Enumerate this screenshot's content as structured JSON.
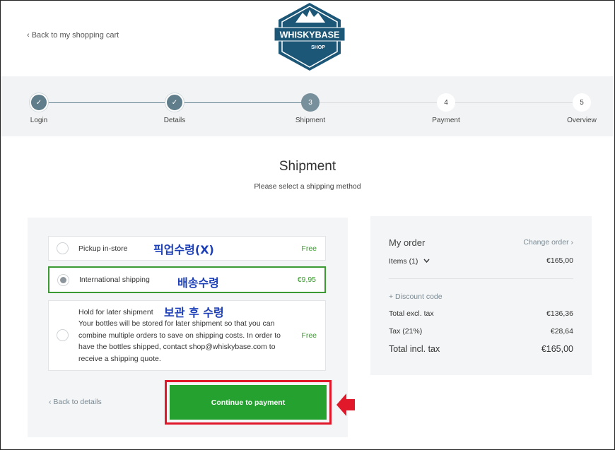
{
  "header": {
    "back_to_cart": "‹ Back to my shopping cart",
    "logo_text": "WHISKYBASE",
    "logo_subtext": "SHOP"
  },
  "steps": [
    {
      "number": "✓",
      "label": "Login",
      "state": "done"
    },
    {
      "number": "✓",
      "label": "Details",
      "state": "done"
    },
    {
      "number": "3",
      "label": "Shipment",
      "state": "current"
    },
    {
      "number": "4",
      "label": "Payment",
      "state": "todo"
    },
    {
      "number": "5",
      "label": "Overview",
      "state": "todo"
    }
  ],
  "page": {
    "title": "Shipment",
    "subtitle": "Please select a shipping method"
  },
  "shipping_options": [
    {
      "label": "Pickup in-store",
      "price": "Free",
      "annotation": "픽업수령(X)",
      "selected": false
    },
    {
      "label": "International shipping",
      "price": "€9,95",
      "annotation": "배송수령",
      "selected": true
    },
    {
      "label": "Hold for later shipment",
      "price": "Free",
      "annotation": "보관 후 수령",
      "selected": false,
      "description": "Your bottles will be stored for later shipment so that you can combine multiple orders to save on shipping costs. In order to have the bottles shipped, contact shop@whiskybase.com to receive a shipping quote."
    }
  ],
  "actions": {
    "back_to_details": "‹ Back to details",
    "continue": "Continue to payment"
  },
  "order": {
    "title": "My order",
    "change_order": "Change order ›",
    "items_label": "Items (1)",
    "items_value": "€165,00",
    "discount": "+ Discount code",
    "excl_label": "Total excl. tax",
    "excl_value": "€136,36",
    "tax_label": "Tax (21%)",
    "tax_value": "€28,64",
    "incl_label": "Total incl. tax",
    "incl_value": "€165,00"
  },
  "colors": {
    "accent_green": "#24a12e",
    "selected_border": "#3c9a32",
    "annotation_red": "#e0182a",
    "annotation_blue": "#1c3fb8",
    "logo_blue": "#1d5778"
  }
}
